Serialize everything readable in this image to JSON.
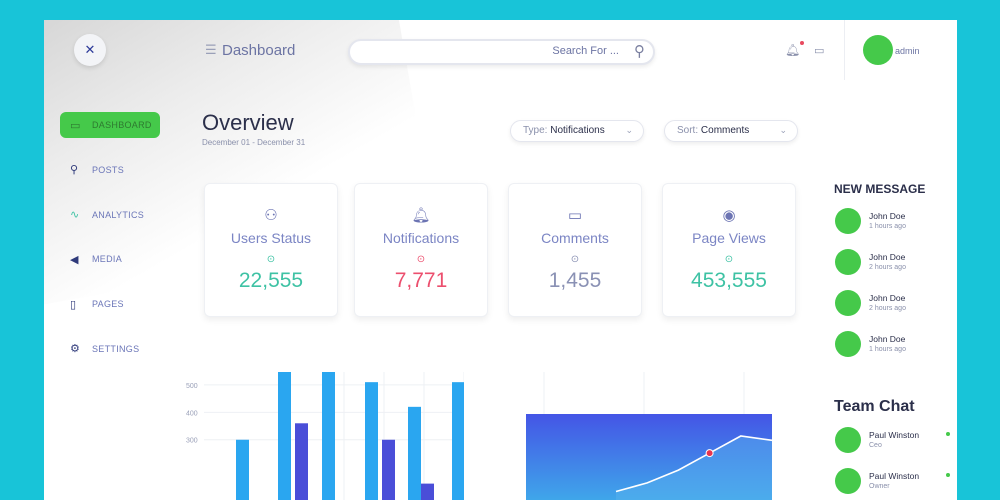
{
  "header": {
    "title": "Dashboard",
    "search_placeholder": "Search For ...",
    "admin_name": "admin"
  },
  "sidebar": {
    "items": [
      {
        "label": "DASHBOARD",
        "icon": "dashboard-icon",
        "active": true
      },
      {
        "label": "POSTS",
        "icon": "pin-icon",
        "active": false
      },
      {
        "label": "ANALYTICS",
        "icon": "analytics-icon",
        "active": false
      },
      {
        "label": "MEDIA",
        "icon": "megaphone-icon",
        "active": false
      },
      {
        "label": "PAGES",
        "icon": "page-icon",
        "active": false
      },
      {
        "label": "SETTINGS",
        "icon": "gear-icon",
        "active": false
      }
    ]
  },
  "overview": {
    "title": "Overview",
    "date_range": "December 01 - December 31",
    "type_prefix": "Type:",
    "type_value": "Notifications",
    "sort_prefix": "Sort:",
    "sort_value": "Comments"
  },
  "stats": [
    {
      "label": "Users Status",
      "value": "22,555",
      "icon": "user-icon",
      "color": "#3ec2a4"
    },
    {
      "label": "Notifications",
      "value": "7,771",
      "icon": "bell-icon",
      "color": "#ec4f6e"
    },
    {
      "label": "Comments",
      "value": "1,455",
      "icon": "comment-icon",
      "color": "#8a91b4"
    },
    {
      "label": "Page Views",
      "value": "453,555",
      "icon": "eye-icon",
      "color": "#3ec2a4"
    }
  ],
  "new_message": {
    "title": "NEW MESSAGE",
    "items": [
      {
        "name": "John Doe",
        "time": "1 hours ago"
      },
      {
        "name": "John Doe",
        "time": "2 hours ago"
      },
      {
        "name": "John Doe",
        "time": "2 hours ago"
      },
      {
        "name": "John Doe",
        "time": "1 hours ago"
      }
    ]
  },
  "team_chat": {
    "title": "Team Chat",
    "items": [
      {
        "name": "Paul Winston",
        "role": "Ceo",
        "online": true
      },
      {
        "name": "Paul Winston",
        "role": "Owner",
        "online": true
      }
    ]
  },
  "colors": {
    "accent_green": "#45c94a",
    "bar_light": "#2aa6f0",
    "bar_dark": "#4a4ed8",
    "area_top": "#4455e6",
    "area_bottom": "#3fa6ea",
    "marker": "#e8344f"
  },
  "chart_data": [
    {
      "type": "bar",
      "ylabels": [
        "500",
        "400",
        "300"
      ],
      "ylim": [
        0,
        620
      ],
      "series": [
        {
          "values": [
            300,
            550,
            550,
            510,
            420,
            510
          ]
        },
        {
          "values": [
            null,
            360,
            null,
            300,
            140,
            null
          ]
        }
      ],
      "grid": true
    },
    {
      "type": "area",
      "x": [
        0,
        1,
        2,
        3,
        4,
        5
      ],
      "values": [
        4,
        8,
        14,
        22,
        30,
        28
      ],
      "ylim": [
        0,
        60
      ],
      "marker_index": 3,
      "grid": true
    }
  ]
}
